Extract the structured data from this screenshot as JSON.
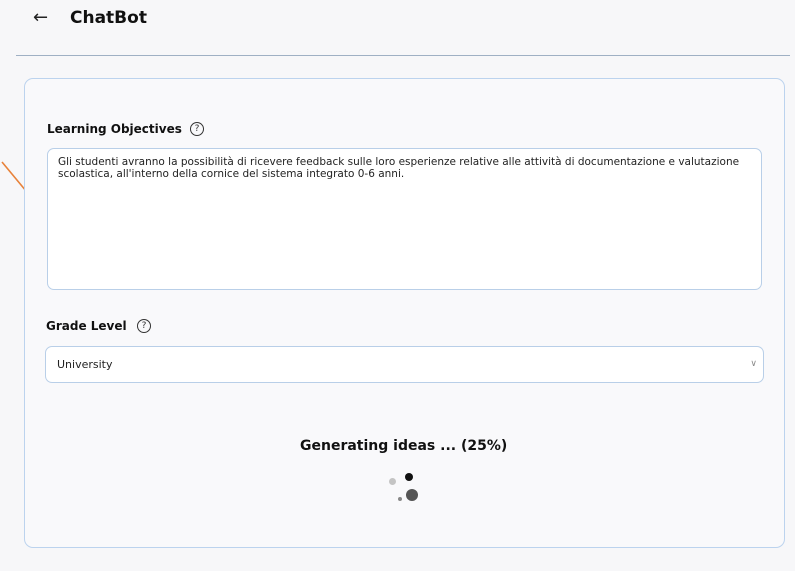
{
  "header": {
    "back_icon": "arrow-left-icon",
    "title": "ChatBot"
  },
  "form": {
    "learning_objectives": {
      "label": "Learning Objectives",
      "help_icon": "question-circle-icon",
      "help_glyph": "?",
      "value": "Gli studenti avranno la possibilità di ricevere feedback sulle loro esperienze relative alle attività di documentazione e valutazione scolastica, all'interno della cornice del sistema integrato 0-6 anni."
    },
    "grade_level": {
      "label": "Grade Level",
      "help_icon": "question-circle-icon",
      "help_glyph": "?",
      "selected": "University"
    }
  },
  "status": {
    "text": "Generating ideas ... (25%)",
    "progress_percent": 25
  },
  "annotation": {
    "arrow_color": "#e8823a"
  },
  "colors": {
    "border": "#bcd3ee",
    "background": "#f7f7f9"
  }
}
